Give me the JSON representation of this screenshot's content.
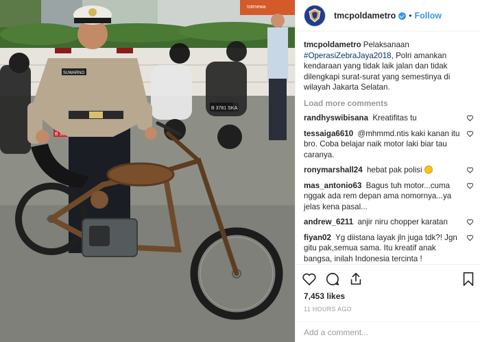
{
  "post": {
    "username": "tmcpoldametro",
    "follow_separator": "•",
    "follow_label": "Follow",
    "caption_user": "tmcpoldametro",
    "caption_pre": "Pelaksanaan ",
    "caption_tag": "#OperasiZebraJaya2018",
    "caption_post": ", Polri amankan kendaraan yang tidak laik jalan dan tidak dilengkapi surat-surat yang semestinya di wilayah Jakarta Selatan.",
    "load_more": "Load more comments",
    "comments": [
      {
        "user": "randhyswibisana",
        "text": "Kreatifitas tu"
      },
      {
        "user": "tessaiga6610",
        "text": "@mhmmd.ntis kaki kanan itu bro. Coba belajar naik motor laki biar tau caranya."
      },
      {
        "user": "ronymarshall24",
        "text": "hebat pak polisi"
      },
      {
        "user": "mas_antonio63",
        "text": "Bagus tuh motor...cuma nggak ada rem depan ama nomornya...ya jelas kena pasal..."
      },
      {
        "user": "andrew_6211",
        "text": "anjir niru chopper karatan"
      },
      {
        "user": "fiyan02",
        "text": "Yg diistana layak jln juga tdk?! Jgn gitu pak,semua sama. Itu kreatif anak bangsa, inilah Indonesia tercinta !"
      }
    ],
    "likes": "7,453 likes",
    "time": "11 HOURS AGO",
    "add_comment_placeholder": "Add a comment..."
  },
  "photo": {
    "sign_top": "Istimewa",
    "name_tag": "SUWARNO",
    "plate_left": "B 3091",
    "plate_right": "B 3781 SKA",
    "description_icons": [
      "heart-icon",
      "comment-icon",
      "share-icon",
      "bookmark-icon"
    ]
  },
  "colors": {
    "accent": "#3897f0",
    "text": "#262626",
    "muted": "#999999"
  }
}
